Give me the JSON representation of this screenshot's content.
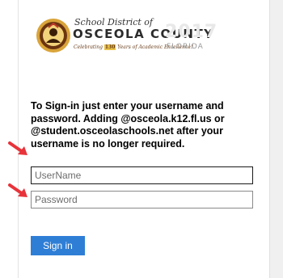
{
  "logo": {
    "line1": "School District of",
    "line2": "OSCEOLA COUNTY",
    "line3_pre": "Celebrating ",
    "line3_num": "130",
    "line3_post": " Years of Academic Excellence!",
    "year": "2017",
    "state": "FLORIDA"
  },
  "instructions": "To Sign-in just enter your username and password. Adding @osceola.k12.fl.us or @student.osceolaschools.net after your username is no longer required.",
  "username": {
    "placeholder": "UserName",
    "value": ""
  },
  "password": {
    "placeholder": "Password",
    "value": ""
  },
  "signin_label": "Sign in",
  "colors": {
    "button": "#2e7ed6",
    "arrow": "#e8333a"
  }
}
